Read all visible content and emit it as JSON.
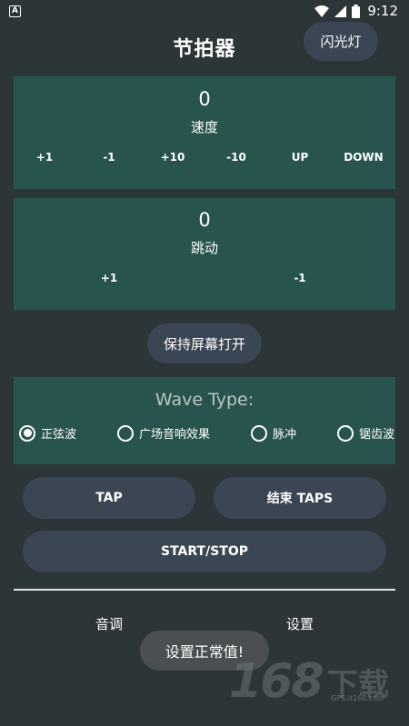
{
  "status_bar": {
    "time": "9:12",
    "app_badge": "A"
  },
  "header": {
    "title": "节拍器",
    "flash_label": "闪光灯"
  },
  "tempo": {
    "value": "0",
    "label": "速度",
    "buttons": [
      "+1",
      "-1",
      "+10",
      "-10",
      "UP",
      "DOWN"
    ]
  },
  "beat": {
    "value": "0",
    "label": "跳动",
    "buttons": [
      "+1",
      "-1"
    ]
  },
  "keep_screen_label": "保持屏幕打开",
  "wave": {
    "title": "Wave Type:",
    "options": [
      "正弦波",
      "广场音响效果",
      "脉冲",
      "锯齿波"
    ],
    "selected": "正弦波"
  },
  "controls": {
    "tap": "TAP",
    "end_taps": "结束 TAPS",
    "start_stop": "START/STOP"
  },
  "bottom_tabs": [
    "音调",
    "设置"
  ],
  "toast": "设置正常值!",
  "watermark": {
    "digits": "168",
    "text": "下载",
    "url": "GPS.it168.com"
  },
  "colors": {
    "background": "#2c3537",
    "panel": "#28544f",
    "button": "#3a4653",
    "toast": "#4b4f51"
  }
}
